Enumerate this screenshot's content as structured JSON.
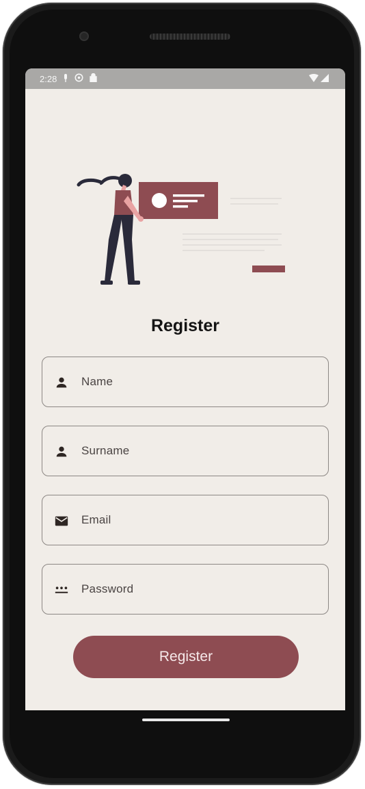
{
  "status_bar": {
    "time": "2:28",
    "icons": [
      "mic-icon",
      "nfc-icon",
      "lock-icon",
      "wifi-icon",
      "signal-icon"
    ]
  },
  "illustration": {
    "name": "woman-holding-profile-card"
  },
  "page": {
    "title": "Register"
  },
  "form": {
    "fields": [
      {
        "label": "Name",
        "icon": "person-icon"
      },
      {
        "label": "Surname",
        "icon": "person-icon"
      },
      {
        "label": "Email",
        "icon": "mail-icon"
      },
      {
        "label": "Password",
        "icon": "password-icon"
      }
    ],
    "submit_label": "Register"
  },
  "colors": {
    "accent": "#8e4c52",
    "background": "#f1ede8",
    "text": "#141414",
    "field_border": "#8c8784"
  }
}
